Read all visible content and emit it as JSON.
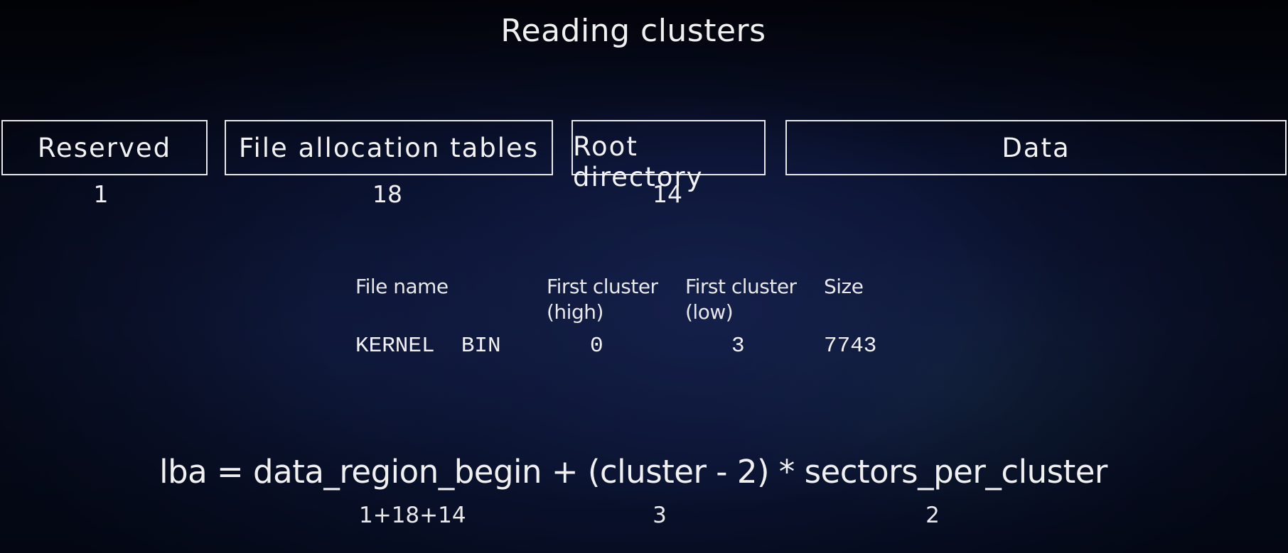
{
  "title": "Reading clusters",
  "regions": [
    {
      "label": "Reserved",
      "count": "1"
    },
    {
      "label": "File allocation tables",
      "count": "18"
    },
    {
      "label": "Root directory",
      "count": "14"
    },
    {
      "label": "Data",
      "count": ""
    }
  ],
  "directory_entry": {
    "headers": {
      "file_name": "File name",
      "first_cluster_high": "First cluster\n(high)",
      "first_cluster_low": "First cluster\n(low)",
      "size": "Size"
    },
    "row": {
      "file_name": "KERNEL  BIN",
      "first_cluster_high": "0",
      "first_cluster_low": "3",
      "size": "7743"
    }
  },
  "formula": {
    "text": "lba = data_region_begin + (cluster - 2) * sectors_per_cluster",
    "data_region_begin_value": "1+18+14",
    "cluster_value": "3",
    "sectors_per_cluster_value": "2"
  }
}
